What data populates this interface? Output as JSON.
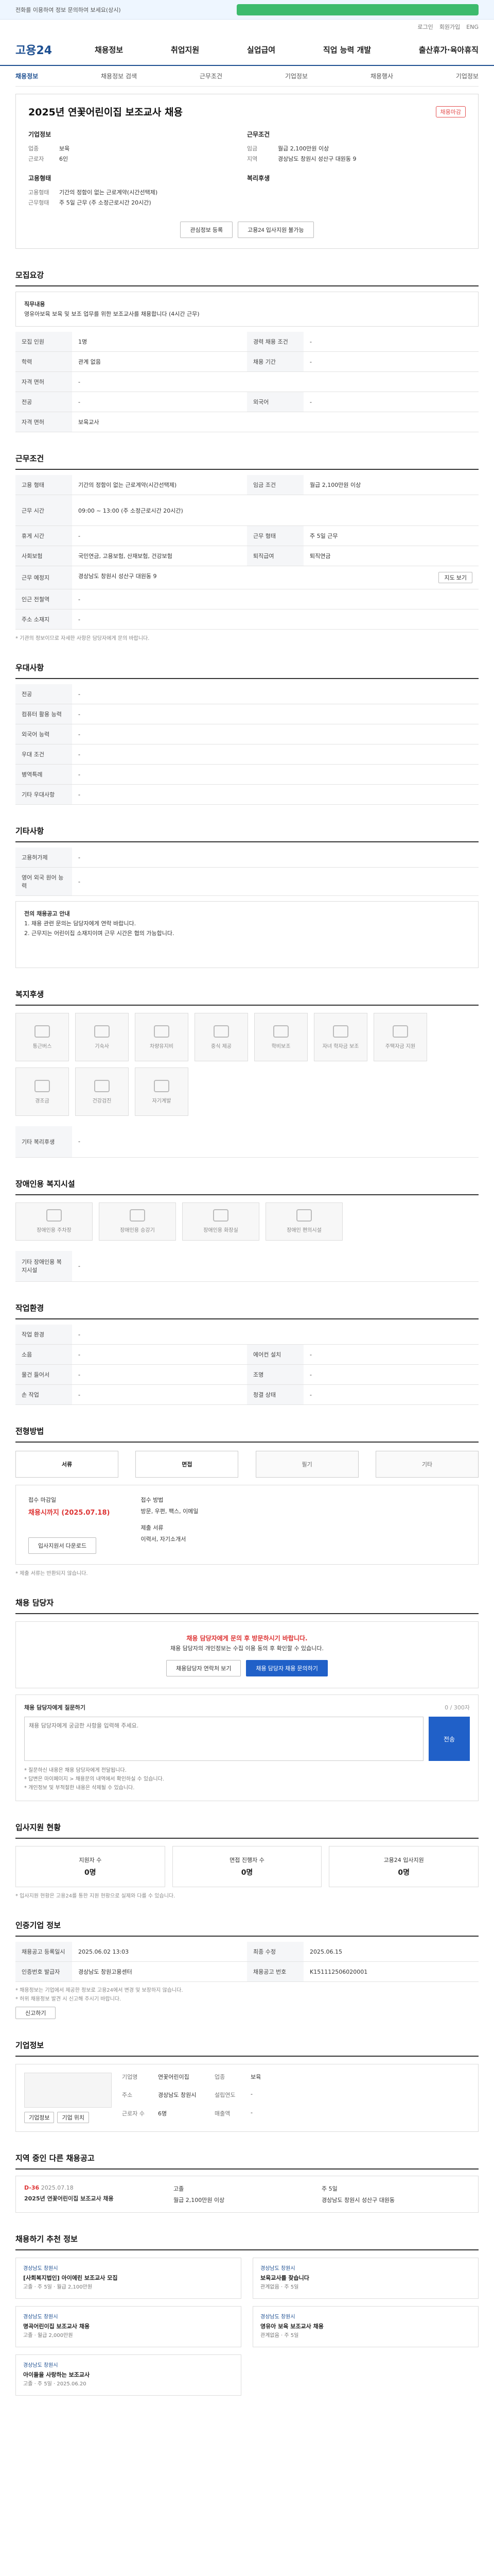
{
  "topbar": {
    "notice": "전화를 이용하여 정보 문의하여 보세요(상시)"
  },
  "util": [
    "로그인",
    "회원가입",
    "ENG"
  ],
  "header": {
    "logo": "고용24",
    "menu": [
      "채용정보",
      "취업지원",
      "실업급여",
      "직업 능력 개발",
      "출산휴가·육아휴직"
    ]
  },
  "subnav": [
    "채용정보",
    "채용정보 검색",
    "근무조건",
    "기업정보",
    "채용행사",
    "기업정보"
  ],
  "job": {
    "badge": "채용마감",
    "title": "2025년 연꽃어린이집 보조교사 채용",
    "company_heading": "기업정보",
    "company": [
      {
        "k": "업종",
        "v": "보육"
      },
      {
        "k": "근로자",
        "v": "6인"
      }
    ],
    "conditions_heading": "근무조건",
    "conditions": [
      {
        "k": "임금",
        "v": "월급 2,100만원 이상"
      },
      {
        "k": "지역",
        "v": "경상남도 창원시 성산구 대원동 9"
      }
    ],
    "employment_heading": "고용형태",
    "employment": [
      {
        "k": "고용형태",
        "v": "기간의 정함이 없는 근로계약(시간선택제)"
      },
      {
        "k": "근무형태",
        "v": "주 5일 근무 (주 소정근로시간 20시간)"
      }
    ],
    "benefits_heading": "복리후생",
    "btn_scrap": "관심정보 등록",
    "btn_apply": "고용24 입사지원 불가능"
  },
  "sections": {
    "recruit": "모집요강",
    "work": "근무조건",
    "prefer": "우대사항",
    "etc": "기타사항",
    "welfare": "복지후생",
    "disabled": "장애인용 복지시설",
    "env": "작업환경",
    "process": "전형방법",
    "contact": "채용 담당자",
    "stats": "입사지원 현황",
    "reginfo": "인증기업 정보",
    "company": "기업정보",
    "compare": "지역 중인 다른 채용공고",
    "recs": "채용하기 추천 정보"
  },
  "recruit": {
    "desc_title": "직무내용",
    "desc": "영유아보육 보육 및 보조 업무를 위한 보조교사를 채용합니다 (4시간 근무)",
    "rows": [
      {
        "k": "모집 인원",
        "v": "1명",
        "k2": "경력 채용 조건",
        "v2": "-"
      },
      {
        "k": "학력",
        "v": "관계 없음",
        "k2": "채용 기간",
        "v2": "-"
      },
      {
        "k": "자격 면허",
        "v": "-",
        "k2": "",
        "v2": ""
      },
      {
        "k": "전공",
        "v": "-",
        "k2": "외국어",
        "v2": "-"
      },
      {
        "k": "자격 면허",
        "v": "보육교사",
        "k2": "",
        "v2": ""
      }
    ]
  },
  "work": {
    "rows": [
      {
        "k": "고용 형태",
        "v": "기간의 정함이 없는 근로계약(시간선택제)",
        "k2": "임금 조건",
        "v2": "월급 2,100만원 이상"
      },
      {
        "k": "근무 시간",
        "v": "09:00 ~ 13:00 (주 소정근로시간 20시간)",
        "k2": "",
        "v2": ""
      },
      {
        "k": "휴게 시간",
        "v": "-",
        "k2": "근무 형태",
        "v2": "주 5일 근무"
      },
      {
        "k": "사회보험",
        "v": "국민연금, 고용보험, 산재보험, 건강보험",
        "k2": "퇴직급여",
        "v2": "퇴직연금"
      },
      {
        "k": "근무 예정지",
        "v": "경상남도 창원시 성산구 대원동 9",
        "k2": "",
        "v2": ""
      },
      {
        "k": "인근 전철역",
        "v": "-",
        "k2": "",
        "v2": ""
      },
      {
        "k": "주소 소재지",
        "v": "-",
        "k2": "",
        "v2": ""
      }
    ],
    "map_btn": "지도 보기",
    "note": "* 기관의 정보이므로 자세한 사항은 담당자에게 문의 바랍니다."
  },
  "prefer": {
    "rows": [
      {
        "k": "전공",
        "v": "-"
      },
      {
        "k": "컴퓨터 활용 능력",
        "v": "-"
      },
      {
        "k": "외국어 능력",
        "v": "-"
      },
      {
        "k": "우대 조건",
        "v": "-"
      },
      {
        "k": "병역특례",
        "v": "-"
      },
      {
        "k": "기타 우대사항",
        "v": "-"
      }
    ]
  },
  "etc": {
    "rows": [
      {
        "k": "고용허가제",
        "v": "-"
      },
      {
        "k": "영어 외국 원어 능력",
        "v": "-"
      }
    ],
    "box_title": "전의 채용공고 안내",
    "box_lines": [
      "1. 채용 관련 문의는 담당자에게 연락 바랍니다.",
      "2. 근무지는 어린이집 소재지이며 근무 시간은 협의 가능합니다."
    ]
  },
  "welfare": {
    "items": [
      "통근버스",
      "기숙사",
      "차량유지비",
      "중식 제공",
      "학비보조",
      "자녀 학자금 보조",
      "주택자금 지원",
      "경조금",
      "건강검진",
      "자기계발"
    ],
    "other_k": "기타 복리후생",
    "other_v": "-"
  },
  "disabled": {
    "items": [
      "장애인용 주차장",
      "장애인용 승강기",
      "장애인용 화장실",
      "장애인 편의시설"
    ],
    "other_k": "기타 장애인용 복지시설",
    "other_v": "-"
  },
  "env": {
    "rows": [
      {
        "k": "작업 환경",
        "v": "-",
        "k2": "",
        "v2": ""
      },
      {
        "k": "소음",
        "v": "-",
        "k2": "에어컨 설치",
        "v2": "-"
      },
      {
        "k": "물건 들어서",
        "v": "-",
        "k2": "조명",
        "v2": "-"
      },
      {
        "k": "손 작업",
        "v": "-",
        "k2": "청결 상태",
        "v2": "-"
      }
    ]
  },
  "process": {
    "steps": [
      "서류",
      "면접",
      "필기",
      "기타"
    ],
    "deadline_label": "접수 마감일",
    "deadline": "채용시까지 (2025.07.18)",
    "method_label": "접수 방법",
    "method": "방문, 우편, 팩스, 이메일",
    "doc_label": "제출 서류",
    "doc": "이력서, 자기소개서",
    "btn": "입사지원서 다운로드",
    "note": "* 제출 서류는 반환되지 않습니다."
  },
  "contact": {
    "warn": "채용 담당자에게 문의 후 방문하시기 바랍니다.",
    "line1": "채용 담당자의 개인정보는 수집 이용 동의 후 확인할 수 있습니다.",
    "btn1": "채용담당자 연락처 보기",
    "btn2": "채용 담당자 채용 문의하기"
  },
  "qa": {
    "label": "채용 담당자에게 질문하기",
    "count": "0 / 300자",
    "placeholder": "채용 담당자에게 궁금한 사항을 입력해 주세요.",
    "send": "전송",
    "notes": [
      "* 질문하신 내용은 채용 담당자에게 전달됩니다.",
      "* 답변은 마이페이지 > 채용문의 내역에서 확인하실 수 있습니다.",
      "* 개인정보 및 부적절한 내용은 삭제될 수 있습니다."
    ]
  },
  "stats": [
    {
      "label": "지원자 수",
      "num": "0명"
    },
    {
      "label": "면접 진행자 수",
      "num": "0명"
    },
    {
      "label": "고용24 입사지원",
      "num": "0명"
    }
  ],
  "stats_note": "* 입사지원 현황은 고용24를 통한 지원 현황으로 실제와 다를 수 있습니다.",
  "reg": {
    "rows": [
      {
        "k": "채용공고 등록일시",
        "v": "2025.06.02 13:03",
        "k2": "최종 수정",
        "v2": "2025.06.15"
      },
      {
        "k": "인증번호 발급자",
        "v": "경상남도 창원고용센터",
        "k2": "채용공고 번호",
        "v2": "K151112506020001"
      }
    ],
    "notes": [
      "* 채용정보는 기업에서 제공한 정보로 고용24에서 변경 및 보장하지 않습니다.",
      "* 허위 채용정보 발견 시 신고해 주시기 바랍니다."
    ],
    "report_btn": "신고하기"
  },
  "company": {
    "rows": [
      {
        "k": "기업명",
        "v": "연꽃어린이집",
        "k2": "업종",
        "v2": "보육"
      },
      {
        "k": "주소",
        "v": "경상남도 창원시",
        "k2": "설립연도",
        "v2": "-"
      },
      {
        "k": "근로자 수",
        "v": "6명",
        "k2": "매출액",
        "v2": "-"
      }
    ],
    "btn1": "기업정보",
    "btn2": "기업 위치"
  },
  "compare": {
    "date": "D-36",
    "date2": "2025.07.18",
    "title": "2025년 연꽃어린이집 보조교사 채용",
    "items": [
      "고졸",
      "주 5일",
      "월급 2,100만원 이상",
      "경상남도 창원시 성산구 대원동"
    ]
  },
  "recs": [
    {
      "tag": "경상남도 창원시",
      "t": "[사회복지법인] 아이에린 보조교사 모집",
      "m": "고졸 · 주 5일 · 월급 2,100만원"
    },
    {
      "tag": "경상남도 창원시",
      "t": "보육교사를 찾습니다",
      "m": "관계없음 · 주 5일"
    },
    {
      "tag": "경상남도 창원시",
      "t": "명곡어린이집 보조교사 채용",
      "m": "고졸 · 월급 2,000만원"
    },
    {
      "tag": "경상남도 창원시",
      "t": "영유아 보육 보조교사 채용",
      "m": "관계없음 · 주 5일"
    },
    {
      "tag": "경상남도 창원시",
      "t": "아이들을 사랑하는 보조교사",
      "m": "고졸 · 주 5일 · 2025.06.20"
    }
  ]
}
